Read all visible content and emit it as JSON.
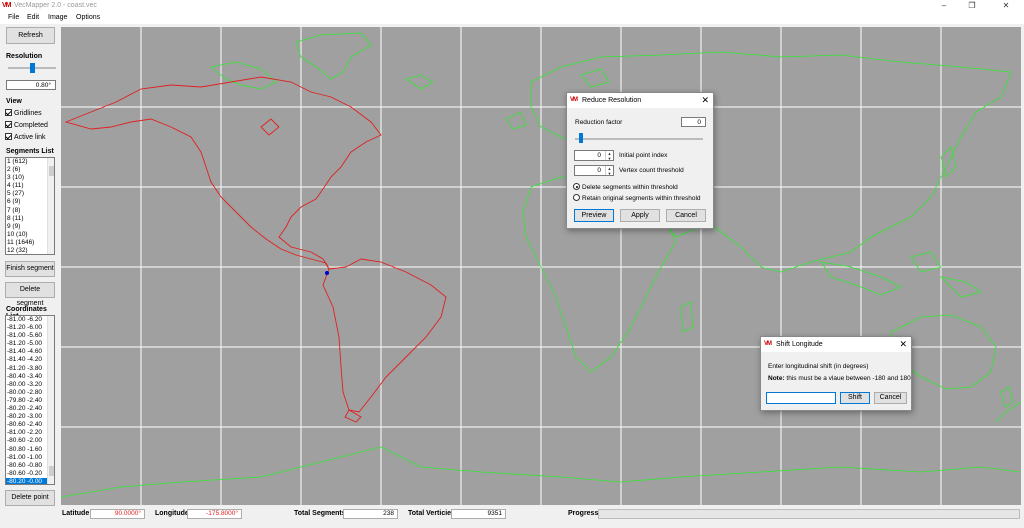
{
  "window": {
    "title": "VecMapper 2.0 - coast.vec",
    "icon": "VM"
  },
  "menu": [
    "File",
    "Edit",
    "Image",
    "Options"
  ],
  "sidebar": {
    "refresh_label": "Refresh",
    "resolution_label": "Resolution",
    "resolution_value": "0.80°",
    "resolution_level": 0.5,
    "view_label": "View",
    "view_items": [
      {
        "label": "Gridlines",
        "checked": true
      },
      {
        "label": "Completed",
        "checked": true
      },
      {
        "label": "Active link",
        "checked": true
      }
    ],
    "segments_label": "Segments List",
    "segments": [
      "1 (612)",
      "2 (6)",
      "3 (10)",
      "4 (11)",
      "5 (27)",
      "6 (9)",
      "7 (8)",
      "8 (11)",
      "9 (9)",
      "10 (10)",
      "11 (1646)",
      "12 (32)"
    ],
    "finish_segment_label": "Finish segment",
    "delete_segment_label": "Delete segment",
    "coordinates_label": "Coordinates List",
    "coordinates": [
      "-81.00 -6.20",
      "-81.20 -6.00",
      "-81.00 -5.60",
      "-81.20 -5.00",
      "-81.40 -4.60",
      "-81.40 -4.20",
      "-81.20 -3.80",
      "-80.40 -3.40",
      "-80.00 -3.20",
      "-80.00 -2.80",
      "-79.80 -2.40",
      "-80.20 -2.40",
      "-80.20 -3.00",
      "-80.60 -2.40",
      "-81.00 -2.20",
      "-80.60 -2.00",
      "-80.80 -1.60",
      "-81.00 -1.00",
      "-80.60 -0.80",
      "-80.60 -0.20",
      "-80.20 -0.00"
    ],
    "selected_coordinate_index": 20,
    "delete_point_label": "Delete point"
  },
  "status": {
    "latitude_label": "Latitude",
    "latitude_value": "90.0000°",
    "longitude_label": "Longitude",
    "longitude_value": "-175.8000°",
    "total_segments_label": "Total Segments",
    "total_segments_value": "238",
    "total_vertices_label": "Total Verticies",
    "total_vertices_value": "9351",
    "progress_label": "Progress",
    "progress": 0
  },
  "reduce_dialog": {
    "title": "Reduce Resolution",
    "reduction_factor_label": "Reduction factor",
    "reduction_factor_value": "0",
    "initial_index_label": "Initial point index",
    "initial_index_value": "0",
    "vertex_threshold_label": "Vertex count threshold",
    "vertex_threshold_value": "0",
    "option_delete": "Delete segments within threshold",
    "option_retain": "Retain original segments within threshold",
    "preview_label": "Preview",
    "apply_label": "Apply",
    "cancel_label": "Cancel"
  },
  "shift_dialog": {
    "title": "Shift Longitude",
    "prompt": "Enter longitudinal shift (in degrees)",
    "note_bold": "Note:",
    "note_text": " this must be a vlaue between -180 and 180",
    "input_value": "",
    "shift_label": "Shift",
    "cancel_label": "Cancel"
  },
  "colors": {
    "map_bg": "#a0a0a0",
    "land_green": "#32e632",
    "active_red": "#e02020",
    "grid": "#ffffff",
    "accent": "#0078d7"
  }
}
